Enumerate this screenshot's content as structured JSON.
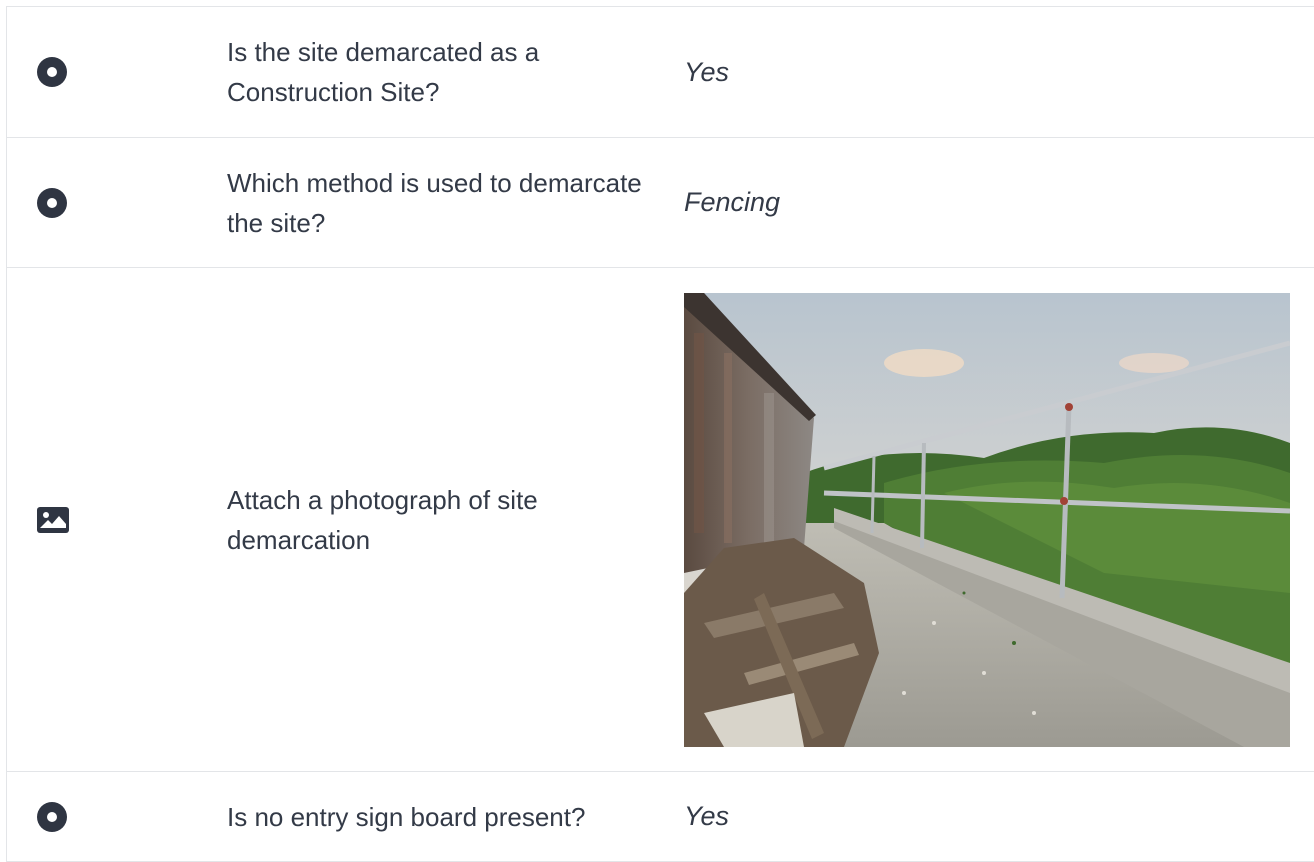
{
  "rows": [
    {
      "icon": "radio-button-icon",
      "question": "Is the site demarcated as a Construction Site?",
      "answer": "Yes"
    },
    {
      "icon": "radio-button-icon",
      "question": "Which method is used to demarcate the site?",
      "answer": "Fencing"
    },
    {
      "icon": "image-icon",
      "question": "Attach a photograph of site demarcation",
      "answer_type": "photo"
    },
    {
      "icon": "radio-button-icon",
      "question": "Is no entry sign board present?",
      "answer": "Yes"
    }
  ],
  "colors": {
    "icon": "#2f3542",
    "border": "#e3e5e8",
    "text": "#333a47"
  }
}
